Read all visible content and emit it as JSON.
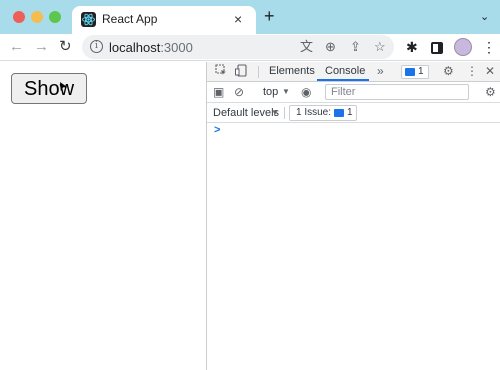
{
  "browser": {
    "tab": {
      "title": "React App",
      "close_glyph": "×",
      "favicon": "react-icon"
    },
    "new_tab_glyph": "+",
    "tab_menu_glyph": "⌄",
    "nav": {
      "back_glyph": "←",
      "forward_glyph": "→",
      "reload_glyph": "↻"
    },
    "omnibox": {
      "host": "localhost",
      "port": ":3000",
      "info_glyph": "i"
    },
    "omnibox_icons": {
      "translate": "文",
      "zoom": "⊕",
      "share": "⇪",
      "star": "☆"
    },
    "toolbar_icons": {
      "extensions": "✱",
      "menu": "⋮"
    }
  },
  "page": {
    "show_button_label": "Show",
    "cursor_glyph": "➤"
  },
  "devtools": {
    "tabs": [
      "Elements",
      "Console"
    ],
    "active_tab": "Console",
    "more_glyph": "»",
    "issues_badge_count": "1",
    "gear_glyph": "⚙",
    "kebab_glyph": "⋮",
    "close_glyph": "✕",
    "console": {
      "sidebar_glyph": "▣",
      "clear_glyph": "⊘",
      "context": "top",
      "dropdown_glyph": "▼",
      "eye_glyph": "◉",
      "filter_placeholder": "Filter",
      "levels": "Default levels",
      "issues_label": "1 Issue:",
      "issues_count": "1",
      "prompt_glyph": ">"
    }
  },
  "colors": {
    "tab_strip": "#a9dceb",
    "accent": "#1a73e8"
  }
}
